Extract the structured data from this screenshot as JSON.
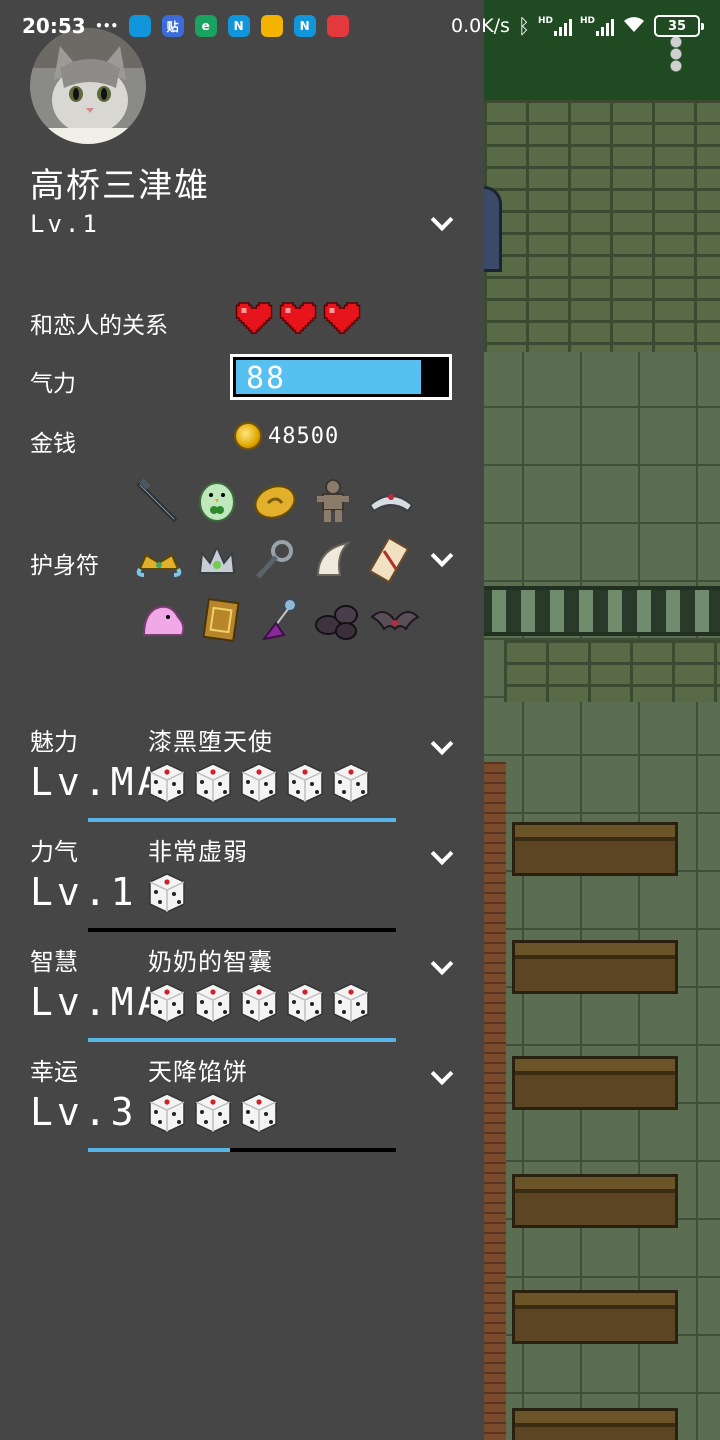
{
  "status_bar": {
    "time": "20:53",
    "network_speed": "0.0K/s",
    "battery": "35",
    "hd1": "HD",
    "hd2": "HD",
    "app_icons": [
      "more-dots-icon",
      "qq-icon",
      "tieba-icon",
      "browser-e-icon",
      "notes-n-icon",
      "weibo-icon",
      "notes-n-icon",
      "netease-music-icon"
    ],
    "app_icon_glyphs": [
      "•••",
      "",
      "贴",
      "e",
      "N",
      "",
      "N",
      ""
    ]
  },
  "player": {
    "name": "高桥三津雄",
    "level": "Lv.1"
  },
  "stats": {
    "relationship_label": "和恋人的关系",
    "hearts": 3,
    "energy_label": "气力",
    "energy_value": "88",
    "energy_fraction": 0.88,
    "money_label": "金钱",
    "money_value": "48500",
    "charms_label": "护身符"
  },
  "charms": [
    [
      "sword-charm-icon",
      "clover-bird-charm-icon",
      "gold-egg-charm-icon",
      "clay-doll-charm-icon",
      "silver-tiara-charm-icon"
    ],
    [
      "gold-crown-charm-icon",
      "jeweled-crown-charm-icon",
      "magnifier-charm-icon",
      "horn-charm-icon",
      "talisman-scroll-charm-icon"
    ],
    [
      "pink-slime-charm-icon",
      "golden-book-charm-icon",
      "bell-tassel-charm-icon",
      "dark-stones-charm-icon",
      "bat-wings-charm-icon"
    ]
  ],
  "attributes": [
    {
      "name": "魅力",
      "title": "漆黑堕天使",
      "level": "Lv.MAX",
      "dice": 5,
      "progress": 1.0
    },
    {
      "name": "力气",
      "title": "非常虚弱",
      "level": "Lv.1",
      "dice": 1,
      "progress": 0.0
    },
    {
      "name": "智慧",
      "title": "奶奶的智囊",
      "level": "Lv.MAX",
      "dice": 5,
      "progress": 1.0
    },
    {
      "name": "幸运",
      "title": "天降馅饼",
      "level": "Lv.3",
      "dice": 3,
      "progress": 0.46
    }
  ],
  "colors": {
    "panel_bg": "#464646",
    "energy_fill": "#56c0f0",
    "progress_fill": "#56b4e6",
    "heart": "#e8141c"
  }
}
